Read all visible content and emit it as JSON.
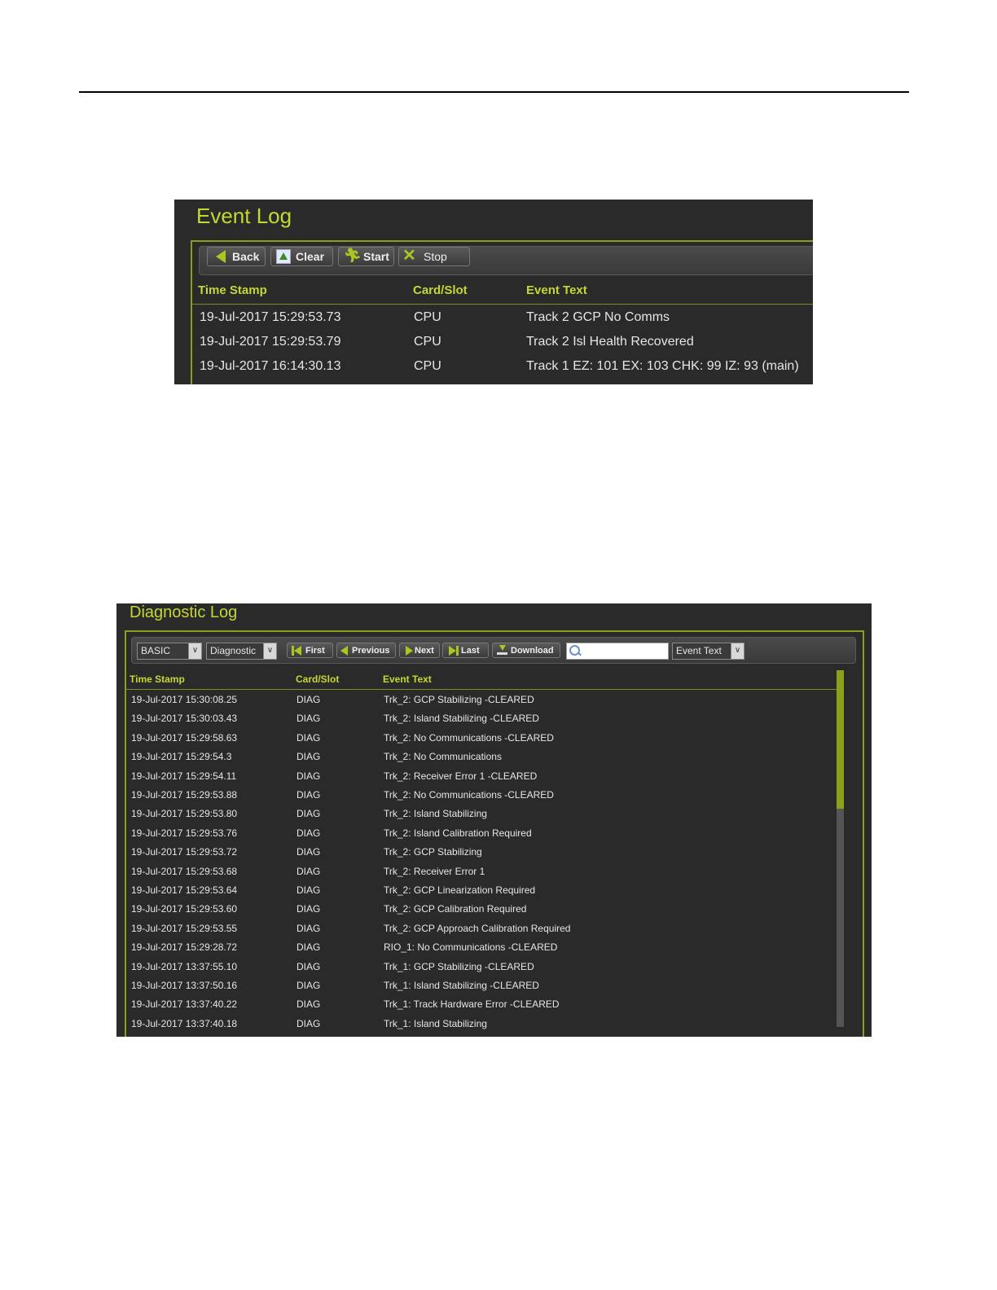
{
  "event_log": {
    "title": "Event Log",
    "buttons": [
      {
        "label": "Back",
        "icon": "back-arrow-icon"
      },
      {
        "label": "Clear",
        "icon": "clear-icon"
      },
      {
        "label": "Start",
        "icon": "start-runner-icon"
      },
      {
        "label": "Stop",
        "icon": "stop-x-icon"
      }
    ],
    "columns": [
      "Time Stamp",
      "Card/Slot",
      "Event Text"
    ],
    "rows": [
      [
        "19-Jul-2017 15:29:53.73",
        "CPU",
        "Track 2 GCP No Comms"
      ],
      [
        "19-Jul-2017 15:29:53.79",
        "CPU",
        "Track 2 Isl Health Recovered"
      ],
      [
        "19-Jul-2017 16:14:30.13",
        "CPU",
        "Track 1 EZ: 101 EX: 103 CHK: 99 IZ: 93 (main)"
      ]
    ]
  },
  "diagnostic_log": {
    "title": "Diagnostic Log",
    "filters": {
      "level": "BASIC",
      "type": "Diagnostic",
      "search_field": "Event Text",
      "search_value": ""
    },
    "buttons": [
      {
        "label": "First",
        "icon": "first-icon"
      },
      {
        "label": "Previous",
        "icon": "previous-icon"
      },
      {
        "label": "Next",
        "icon": "next-icon"
      },
      {
        "label": "Last",
        "icon": "last-icon"
      },
      {
        "label": "Download",
        "icon": "download-icon"
      }
    ],
    "columns": [
      "Time Stamp",
      "Card/Slot",
      "Event Text"
    ],
    "rows": [
      [
        "19-Jul-2017 15:30:08.25",
        "DIAG",
        "Trk_2: GCP Stabilizing -CLEARED"
      ],
      [
        "19-Jul-2017 15:30:03.43",
        "DIAG",
        "Trk_2: Island Stabilizing -CLEARED"
      ],
      [
        "19-Jul-2017 15:29:58.63",
        "DIAG",
        "Trk_2: No Communications -CLEARED"
      ],
      [
        "19-Jul-2017 15:29:54.3",
        "DIAG",
        "Trk_2: No Communications"
      ],
      [
        "19-Jul-2017 15:29:54.11",
        "DIAG",
        "Trk_2: Receiver Error 1 -CLEARED"
      ],
      [
        "19-Jul-2017 15:29:53.88",
        "DIAG",
        "Trk_2: No Communications -CLEARED"
      ],
      [
        "19-Jul-2017 15:29:53.80",
        "DIAG",
        "Trk_2: Island Stabilizing"
      ],
      [
        "19-Jul-2017 15:29:53.76",
        "DIAG",
        "Trk_2: Island Calibration Required"
      ],
      [
        "19-Jul-2017 15:29:53.72",
        "DIAG",
        "Trk_2: GCP Stabilizing"
      ],
      [
        "19-Jul-2017 15:29:53.68",
        "DIAG",
        "Trk_2: Receiver Error 1"
      ],
      [
        "19-Jul-2017 15:29:53.64",
        "DIAG",
        "Trk_2: GCP Linearization Required"
      ],
      [
        "19-Jul-2017 15:29:53.60",
        "DIAG",
        "Trk_2: GCP Calibration Required"
      ],
      [
        "19-Jul-2017 15:29:53.55",
        "DIAG",
        "Trk_2: GCP Approach Calibration Required"
      ],
      [
        "19-Jul-2017 15:29:28.72",
        "DIAG",
        "RIO_1: No Communications -CLEARED"
      ],
      [
        "19-Jul-2017 13:37:55.10",
        "DIAG",
        "Trk_1: GCP Stabilizing -CLEARED"
      ],
      [
        "19-Jul-2017 13:37:50.16",
        "DIAG",
        "Trk_1: Island Stabilizing -CLEARED"
      ],
      [
        "19-Jul-2017 13:37:40.22",
        "DIAG",
        "Trk_1: Track Hardware Error -CLEARED"
      ],
      [
        "19-Jul-2017 13:37:40.18",
        "DIAG",
        "Trk_1: Island Stabilizing"
      ]
    ]
  },
  "colors": {
    "accent": "#c5d832",
    "panel_bg": "#2a2a2a",
    "frame": "#8a9e22"
  }
}
